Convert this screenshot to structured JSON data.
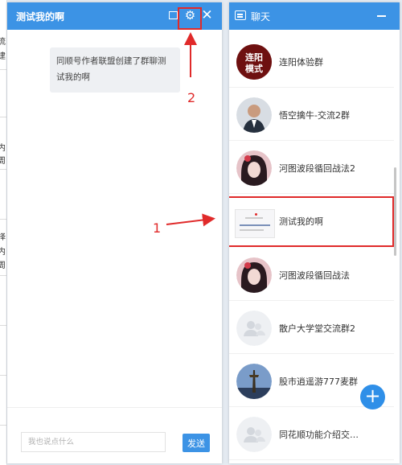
{
  "chat_window": {
    "title": "测试我的啊",
    "system_message": "同顺号作者联盟创建了群聊测试我的啊",
    "input_placeholder": "我也说点什么",
    "send_label": "发送"
  },
  "conversation_list": {
    "title": "聊天",
    "items": [
      {
        "name": "连阳体验群",
        "avatar_text": "连阳模式"
      },
      {
        "name": "悟空擒牛-交流2群"
      },
      {
        "name": "河图波段循回战法2"
      },
      {
        "name": "测试我的啊",
        "selected": true
      },
      {
        "name": "河图波段循回战法"
      },
      {
        "name": "散户大学堂交流群2"
      },
      {
        "name": "股市逍遥游777麦群"
      },
      {
        "name": "同花顺功能介绍交…"
      }
    ]
  },
  "background_fragments": [
    "流",
    "建",
    "内",
    "周",
    "择",
    "内",
    "周"
  ],
  "annotations": {
    "label_1": "1",
    "label_2": "2"
  },
  "colors": {
    "header_blue": "#3c93e5",
    "annotation_red": "#e02a2a"
  },
  "icons": [
    "chat-bubble-icon",
    "minimize-icon",
    "gear-icon",
    "close-icon",
    "collapse-icon",
    "add-icon",
    "group-placeholder-icon"
  ]
}
